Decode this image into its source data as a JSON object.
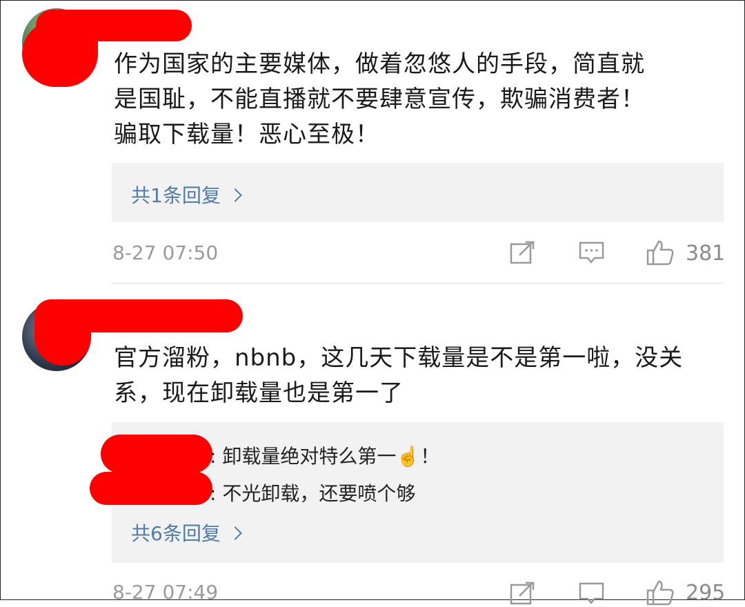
{
  "comments": [
    {
      "text": "作为国家的主要媒体，做着忽悠人的手段，简直就是国耻，不能直播就不要肆意宣传，欺骗消费者！骗取下载量！恶心至极！",
      "lines": [
        "作为国家的主要媒体，做着忽悠人的手段，简直就",
        "是国耻，不能直播就不要肆意宣传，欺骗消费者！",
        "骗取下载量！恶心至极！"
      ],
      "reply_count": "共1条回复",
      "time": "8-27 07:50",
      "likes": "381"
    },
    {
      "lines": [
        "官方溜粉，nbnb，这几天下载量是不是第一啦，没关",
        "系，现在卸载量也是第一了"
      ],
      "replies": [
        {
          "text": ": 卸载量绝对特么第一☝️！"
        },
        {
          "text": ": 不光卸载，还要喷个够"
        }
      ],
      "reply_count": "共6条回复",
      "time": "8-27 07:49",
      "likes": "295"
    }
  ],
  "icons": [
    "share-icon",
    "comment-icon",
    "like-icon"
  ],
  "colors": {
    "link": "#4f7ca8",
    "redaction": "#ff0000",
    "reply_bg": "#f2f2f2"
  }
}
